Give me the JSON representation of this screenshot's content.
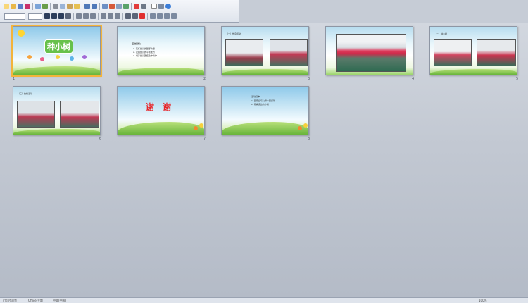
{
  "app": {
    "accent": "#f3b43a"
  },
  "toolbar": {
    "font_name": "",
    "font_size": "",
    "icons_row1": [
      "new-icon",
      "open-icon",
      "save-icon",
      "print-icon",
      "preview-icon",
      "spell-icon",
      "cut-icon",
      "copy-icon",
      "paste-icon",
      "format-painter-icon",
      "undo-icon",
      "redo-icon",
      "table-icon",
      "chart-icon",
      "insert-icon",
      "zoom-icon",
      "help-icon"
    ],
    "icons_row2": [
      "bold-icon",
      "italic-icon",
      "underline-icon",
      "shadow-icon",
      "align-left-icon",
      "align-center-icon",
      "align-right-icon",
      "bullets-icon",
      "numbering-icon",
      "font-color-icon",
      "design-icon",
      "new-slide-icon"
    ]
  },
  "slides": [
    {
      "number": "1",
      "title": "种小树"
    },
    {
      "number": "2",
      "heading": "活动目标：",
      "lines": [
        "1. 锻炼幼儿的腿部力量",
        "2. 发展幼儿的平衡能力",
        "3. 培养幼儿团结合作精神"
      ]
    },
    {
      "number": "3",
      "caption": "（一）热身活动"
    },
    {
      "number": "4",
      "caption": ""
    },
    {
      "number": "5",
      "caption": "（二）种小树"
    },
    {
      "number": "6",
      "caption": "（三）放松活动"
    },
    {
      "number": "7",
      "title": "谢 谢"
    },
    {
      "number": "8",
      "lines": [
        "活动延伸",
        "1. 回家后与父母一起游戏",
        "2. 观察身边的小树"
      ]
    }
  ],
  "statusbar": {
    "slide_indicator": "幻灯片浏览",
    "theme": "Office 主题",
    "language": "中文(中国)",
    "zoom": "100%"
  }
}
